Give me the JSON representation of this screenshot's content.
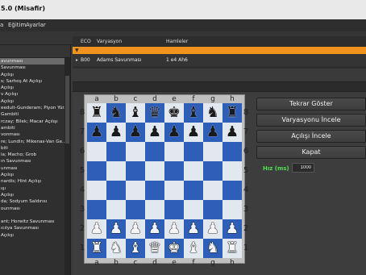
{
  "window": {
    "title": "5.0 (Misafir)"
  },
  "menu": {
    "items": [
      "a",
      "Eğitim",
      "Ayarlar"
    ]
  },
  "sidebar": {
    "items": [
      "avunması",
      "Savunması",
      "Açılışı",
      "s; Sarhoş At Açılışı",
      "Açılışı",
      "v Açılışı",
      "Açılışı",
      "eedult-Gunderam; Piyon Yür...",
      "Gambiti",
      "rczay; Bilek; Macar Açılışı",
      "ambiti",
      "vonması",
      "re; Lundin; Mikenas-Van Ge...",
      "biti",
      "ia; Macho; Grob",
      "ın Savunması",
      "unması",
      "Açılışı",
      "nardis; Hint Açılışı",
      "ışı",
      "Açılışı",
      "da; Sodyum Saldırısı",
      "ounması",
      "",
      "ant; Horwitz Savunması",
      "ıcılya Savunması",
      "Açılışı"
    ],
    "selected_index": 0
  },
  "table": {
    "headers": {
      "eco": "ECO",
      "variation": "Varyasyon",
      "moves": "Hamleler"
    },
    "filter_marker": "▼",
    "rows": [
      {
        "marker": "▸",
        "eco": "B00",
        "variation": "Adams Savunması",
        "moves": "1 e4 Ah6"
      }
    ],
    "accent": "#f2931f"
  },
  "board": {
    "files": [
      "a",
      "b",
      "c",
      "d",
      "e",
      "f",
      "g",
      "h"
    ],
    "ranks": [
      "8",
      "7",
      "6",
      "5",
      "4",
      "3",
      "2",
      "1"
    ],
    "position": [
      [
        "bR",
        "bN",
        "bB",
        "bQ",
        "bK",
        "bB",
        "bN",
        "bR"
      ],
      [
        "bP",
        "bP",
        "bP",
        "bP",
        "bP",
        "bP",
        "bP",
        "bP"
      ],
      [
        "",
        "",
        "",
        "",
        "",
        "",
        "",
        ""
      ],
      [
        "",
        "",
        "",
        "",
        "",
        "",
        "",
        ""
      ],
      [
        "",
        "",
        "",
        "",
        "",
        "",
        "",
        ""
      ],
      [
        "",
        "",
        "",
        "",
        "",
        "",
        "",
        ""
      ],
      [
        "wP",
        "wP",
        "wP",
        "wP",
        "wP",
        "wP",
        "wP",
        "wP"
      ],
      [
        "wR",
        "wN",
        "wB",
        "wQ",
        "wK",
        "wB",
        "wN",
        "wR"
      ]
    ],
    "light_color": "#e3e7ee",
    "dark_color": "#2d5fb8"
  },
  "actions": {
    "replay": "Tekrar Göster",
    "inspect_variation": "Varyasyonu İncele",
    "inspect_opening": "Açılışı İncele",
    "close": "Kapat"
  },
  "speed": {
    "label": "Hız (ms)",
    "value": "1000"
  }
}
